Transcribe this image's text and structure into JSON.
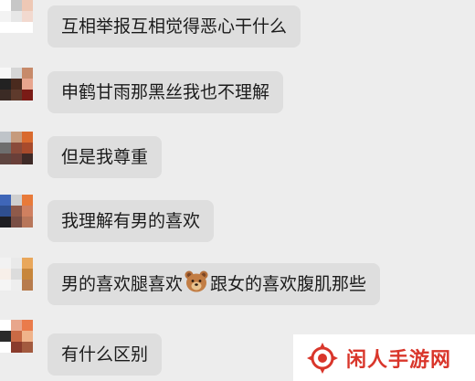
{
  "messages": [
    {
      "text": "互相举报互相觉得恶心干什么",
      "avatar": [
        "#ffffff",
        "#c7c7c7",
        "#eec8b5",
        "#f3f3f3",
        "#e7e7e7",
        "#f2d9cf",
        "#ffffff",
        "#ffffff",
        "#ffffff"
      ]
    },
    {
      "text": "申鹤甘雨那黑丝我也不理解",
      "avatar": [
        "#f7f7f7",
        "#d6d6d6",
        "#c78a6a",
        "#222222",
        "#4a2a1e",
        "#e8a58e",
        "#3b2b25",
        "#5e3a2c",
        "#7a1b16"
      ]
    },
    {
      "text": "但是我尊重",
      "avatar": [
        "#bfc4c9",
        "#c69b7d",
        "#d96a2e",
        "#6e6e6e",
        "#8a4b3a",
        "#a84b2c",
        "#5e4540",
        "#6a3f39",
        "#3e2a27"
      ]
    },
    {
      "text": "我理解有男的喜欢",
      "avatar": [
        "#3f66b8",
        "#cfcfcf",
        "#e87a3a",
        "#2f4f8f",
        "#8f5a4a",
        "#d08060",
        "#1e1e22",
        "#7a4f45",
        "#b8765a"
      ]
    },
    {
      "text_before": "男的喜欢腿喜欢",
      "emoji": "bear-face",
      "text_after": "跟女的喜欢腹肌那些",
      "avatar": [
        "#f2f2f2",
        "#e9e9e9",
        "#e9a75b",
        "#f7efe9",
        "#dcdcdc",
        "#c7863b",
        "#f5f5f5",
        "#eeeeee",
        "#b77b4d"
      ]
    },
    {
      "text": "有什么区别",
      "avatar": [
        "#ffffff",
        "#e8a68c",
        "#ea7b4b",
        "#2b2b2b",
        "#c96a45",
        "#f0b38a",
        "#ffffff",
        "#8a3b2c",
        "#a35a3f"
      ]
    }
  ],
  "watermark": {
    "text": "闲人手游网",
    "color": "#d9362b"
  }
}
